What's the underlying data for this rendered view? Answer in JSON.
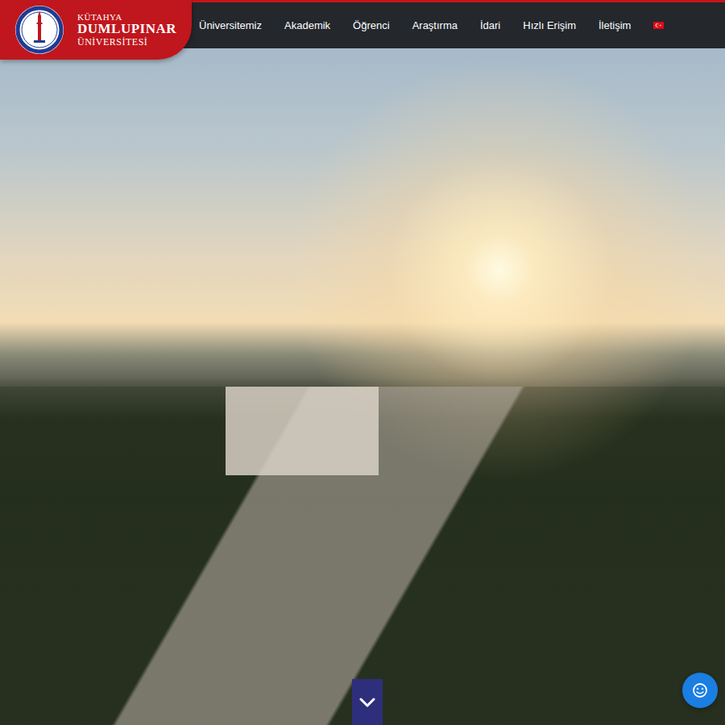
{
  "logo": {
    "line1": "KÜTAHYA",
    "line2": "DUMLUPINAR",
    "line3": "ÜNİVERSİTESİ"
  },
  "nav": {
    "items": [
      {
        "label": "Üniversitemiz"
      },
      {
        "label": "Akademik"
      },
      {
        "label": "Öğrenci"
      },
      {
        "label": "Araştırma"
      },
      {
        "label": "İdari"
      },
      {
        "label": "Hızlı Erişim"
      },
      {
        "label": "İletişim"
      }
    ]
  }
}
